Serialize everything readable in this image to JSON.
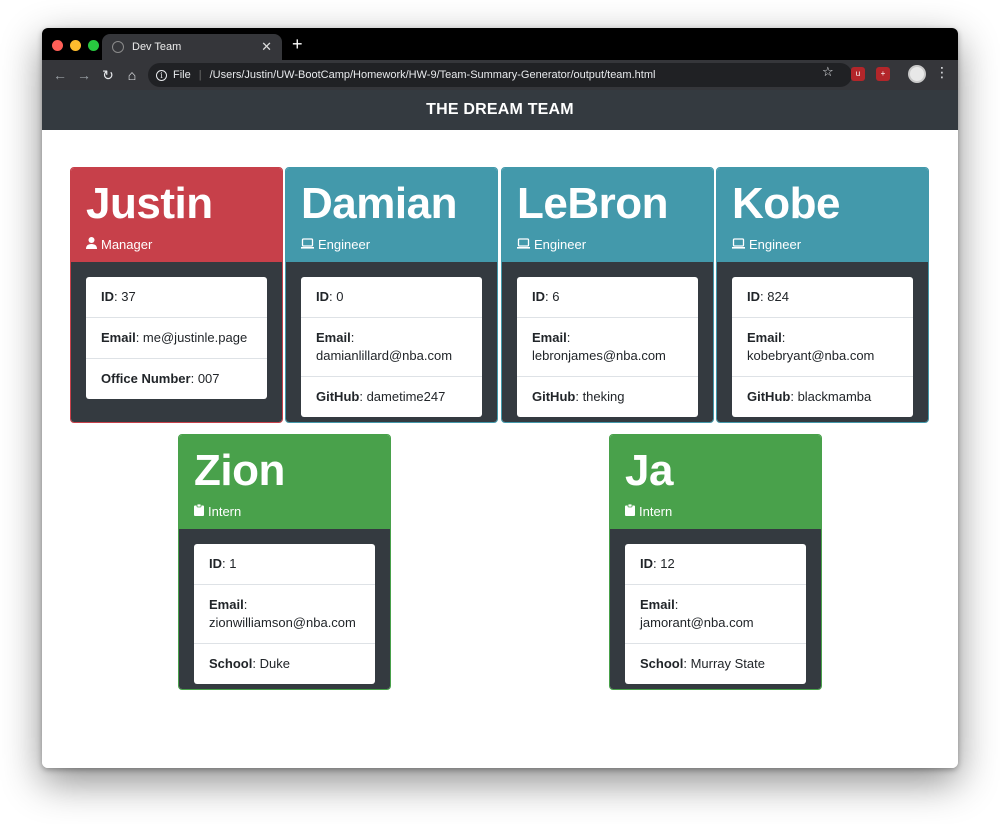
{
  "browser": {
    "tab_title": "Dev Team",
    "new_tab": "+",
    "tab_close": "✕",
    "scheme": "File",
    "url": "/Users/Justin/UW-BootCamp/Homework/HW-9/Team-Summary-Generator/output/team.html",
    "traffic_lights": {
      "close": "#ff5f57",
      "minimize": "#febc2e",
      "maximize": "#28c840"
    }
  },
  "header": {
    "title": "THE DREAM TEAM"
  },
  "labels": {
    "id": "ID",
    "email": "Email",
    "office": "Office Number",
    "github": "GitHub",
    "school": "School"
  },
  "colors": {
    "manager": "#c7404a",
    "engineer": "#4399ab",
    "intern": "#49a14b",
    "body": "#343a40"
  },
  "team": [
    {
      "name": "Justin",
      "role": "Manager",
      "role_icon": "user-tie-icon",
      "id": "37",
      "email": "me@justinle.page",
      "extra_label": "Office Number",
      "extra": "007"
    },
    {
      "name": "Damian",
      "role": "Engineer",
      "role_icon": "laptop-icon",
      "id": "0",
      "email": "damianlillard@nba.com",
      "extra_label": "GitHub",
      "extra": "dametime247"
    },
    {
      "name": "LeBron",
      "role": "Engineer",
      "role_icon": "laptop-icon",
      "id": "6",
      "email": "lebronjames@nba.com",
      "extra_label": "GitHub",
      "extra": "theking"
    },
    {
      "name": "Kobe",
      "role": "Engineer",
      "role_icon": "laptop-icon",
      "id": "824",
      "email": "kobebryant@nba.com",
      "extra_label": "GitHub",
      "extra": "blackmamba"
    },
    {
      "name": "Zion",
      "role": "Intern",
      "role_icon": "clipboard-icon",
      "id": "1",
      "email": "zionwilliamson@nba.com",
      "extra_label": "School",
      "extra": "Duke"
    },
    {
      "name": "Ja",
      "role": "Intern",
      "role_icon": "clipboard-icon",
      "id": "12",
      "email": "jamorant@nba.com",
      "extra_label": "School",
      "extra": "Murray State"
    }
  ]
}
